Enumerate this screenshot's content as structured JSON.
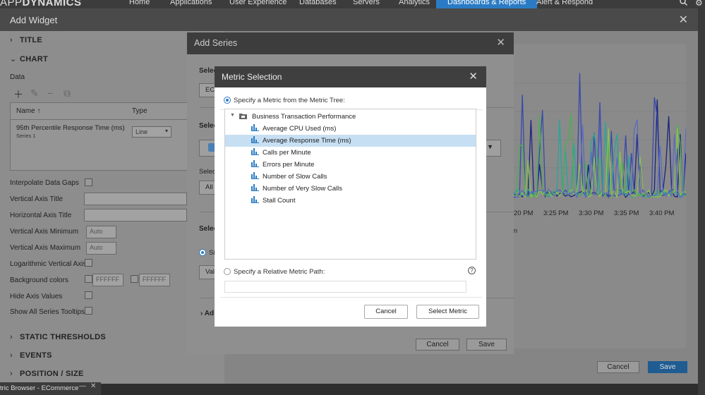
{
  "topnav": {
    "logo_prefix": "APP",
    "logo_suffix": "DYNAMICS",
    "items": [
      "Home",
      "Applications",
      "User Experience",
      "Databases",
      "Servers",
      "Analytics",
      "Dashboards & Reports",
      "Alert & Respond"
    ],
    "active": "Dashboards & Reports"
  },
  "widget": {
    "title": "Add Widget",
    "sections": {
      "title": "TITLE",
      "chart": "CHART",
      "static_thresholds": "STATIC THRESHOLDS",
      "events": "EVENTS",
      "position_size": "POSITION / SIZE"
    },
    "data_label": "Data",
    "table": {
      "col_name": "Name",
      "col_type": "Type",
      "rows": [
        {
          "name": "95th Percentile Response Time (ms)",
          "sub": "Series 1",
          "type": "Line"
        }
      ]
    },
    "fields": {
      "interpolate": "Interpolate Data Gaps",
      "v_axis_title": "Vertical Axis Title",
      "h_axis_title": "Horizontal Axis Title",
      "v_axis_min": "Vertical Axis Minimum",
      "v_axis_max": "Vertical Axis Maximum",
      "log_axis": "Logarithmic Vertical Axis",
      "bg_colors": "Background colors",
      "hide_axis": "Hide Axis Values",
      "show_tooltips": "Show All Series Tooltips"
    },
    "values": {
      "v_axis_min": "Auto",
      "v_axis_max": "Auto",
      "bg_color_1": "FFFFFF",
      "bg_color_2": "FFFFFF"
    },
    "cancel": "Cancel",
    "save": "Save"
  },
  "chart_data": {
    "type": "line",
    "x_ticks": [
      "20 PM",
      "3:25 PM",
      "3:30 PM",
      "3:35 PM",
      "3:40 PM"
    ],
    "series_colors": [
      "#1a237e",
      "#3949ab",
      "#26a69a",
      "#4caf50",
      "#8bc34a",
      "#5c6bc0"
    ]
  },
  "series_dialog": {
    "title": "Add Series",
    "partial_labels": [
      "Selec",
      "Selec",
      "Selec",
      "Selec"
    ],
    "btn_partial": "EC",
    "all_partial": "All",
    "si_partial": "Si",
    "val_partial": "Val",
    "adv_partial": "Ad",
    "cancel": "Cancel",
    "save": "Save"
  },
  "metric_selection": {
    "title": "Metric Selection",
    "option_tree": "Specify a Metric from the Metric Tree:",
    "parent": "Business Transaction Performance",
    "items": [
      "Average CPU Used (ms)",
      "Average Response Time (ms)",
      "Calls per Minute",
      "Errors per Minute",
      "Number of Slow Calls",
      "Number of Very Slow Calls",
      "Stall Count"
    ],
    "selected": "Average Response Time (ms)",
    "option_relative": "Specify a Relative Metric Path:",
    "help": "?",
    "cancel": "Cancel",
    "select": "Select Metric"
  },
  "taskbar": {
    "label": "tric Browser - ECommerce"
  }
}
